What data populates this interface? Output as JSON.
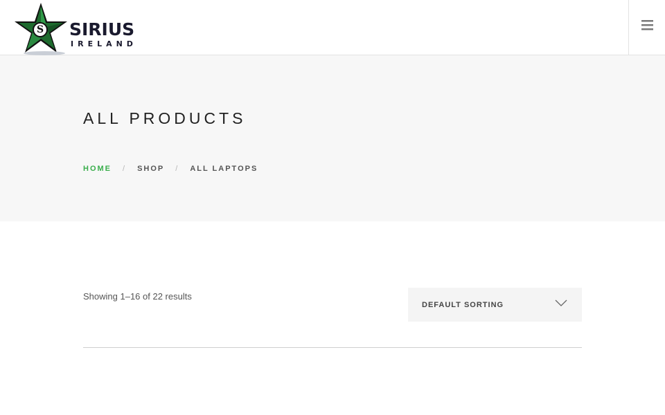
{
  "header": {
    "logo": {
      "name": "SIRIUS",
      "subtitle": "IRELAND",
      "emblem_letter": "S"
    },
    "menu_icon": "hamburger-icon"
  },
  "hero": {
    "title": "ALL PRODUCTS",
    "breadcrumb": [
      {
        "label": "HOME",
        "current": false
      },
      {
        "label": "SHOP",
        "current": false
      },
      {
        "label": "ALL LAPTOPS",
        "current": true
      }
    ],
    "separator": "/"
  },
  "shop": {
    "results_text": "Showing 1–16 of 22 results",
    "sort": {
      "selected": "DEFAULT SORTING",
      "icon": "chevron-down-icon"
    }
  },
  "colors": {
    "accent": "#3aae4c",
    "hero_bg": "#f7f7f7",
    "logo_star": "#1e6b2e",
    "text_dark": "#222222"
  }
}
